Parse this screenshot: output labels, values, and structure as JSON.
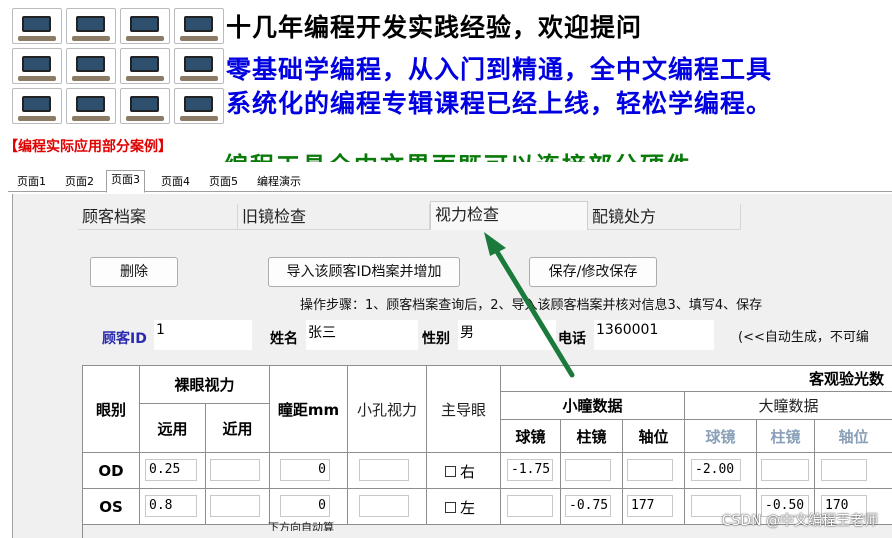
{
  "banner": {
    "line1": "十几年编程开发实践经验，欢迎提问",
    "line2": "零基础学编程，从入门到精通，全中文编程工具",
    "line3": "系统化的编程专辑课程已经上线，轻松学编程。",
    "red_caption": "【编程实际应用部分案例】",
    "green_partial": "编程工具全中文界面既可以连接部分硬件"
  },
  "tabs": [
    "页面1",
    "页面2",
    "页面3",
    "页面4",
    "页面5",
    "编程演示"
  ],
  "subtabs": [
    "顾客档案",
    "旧镜检查",
    "视力检查",
    "配镜处方"
  ],
  "buttons": {
    "delete": "删除",
    "import": "导入该顾客ID档案并增加",
    "save": "保存/修改保存"
  },
  "steps": "操作步骤：1、顾客档案查询后，2、导入该顾客档案并核对信息3、填写4、保存",
  "customer": {
    "id_label": "顾客ID",
    "id_value": "1",
    "name_label": "姓名",
    "name_value": "张三",
    "gender_label": "性别",
    "gender_value": "男",
    "phone_label": "电话",
    "phone_value": "1360001",
    "note": "(<<自动生成，不可编"
  },
  "table": {
    "h_eye": "眼别",
    "h_naked": "裸眼视力",
    "h_far": "远用",
    "h_near": "近用",
    "h_pd": "瞳距mm",
    "h_pinhole": "小孔视力",
    "h_dominant": "主导眼",
    "h_objective": "客观验光数",
    "h_small_pupil": "小瞳数据",
    "h_large_pupil": "大瞳数据",
    "h_sph": "球镜",
    "h_cyl": "柱镜",
    "h_axis": "轴位",
    "rows": [
      {
        "eye": "OD",
        "far": "0.25",
        "near": "",
        "pd": "0",
        "pinhole": "",
        "dominant": "右",
        "s_sph": "-1.75",
        "s_cyl": "",
        "s_axis": "",
        "l_sph": "-2.00",
        "l_cyl": "",
        "l_axis": ""
      },
      {
        "eye": "OS",
        "far": "0.8",
        "near": "",
        "pd": "0",
        "pinhole": "",
        "dominant": "左",
        "s_sph": "",
        "s_cyl": "-0.75",
        "s_axis": "177",
        "l_sph": "",
        "l_cyl": "-0.50",
        "l_axis": "170"
      }
    ],
    "pd_note": "下方向自动算"
  },
  "watermark": "CSDN @中文编程王老师",
  "colors": {
    "accent_arrow": "#1a7a3c",
    "blue_text": "#0000e0",
    "red_text": "#e00000"
  }
}
